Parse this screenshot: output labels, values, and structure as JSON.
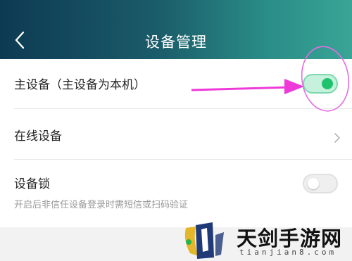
{
  "header": {
    "title": "设备管理",
    "back_icon": "chevron-left-icon"
  },
  "settings": {
    "primary_device": {
      "label": "主设备（主设备为本机）",
      "toggle_on": true
    },
    "online_devices": {
      "label": "在线设备",
      "icon": "chevron-right-icon"
    },
    "device_lock": {
      "label": "设备锁",
      "description": "开启后非信任设备登录时需短信或扫码验证",
      "toggle_on": false
    }
  },
  "annotation": {
    "arrow_color": "#ee3ad8",
    "circle_color": "#e36ee0"
  },
  "watermark": {
    "text": "天剑手游网",
    "url": "tianjian8.com"
  },
  "colors": {
    "header_gradient_start": "#0d3a52",
    "header_gradient_end": "#38a596",
    "toggle_on_knob": "#1fc36e",
    "toggle_on_track": "#c6f2dd"
  }
}
